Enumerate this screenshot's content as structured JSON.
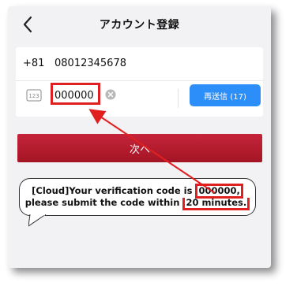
{
  "header": {
    "title": "アカウント登録",
    "back_icon": "chevron-left-icon"
  },
  "form": {
    "phone_prefix": "+81",
    "phone_number": "08012345678",
    "code_value": "000000",
    "keypad_icon_label": "123",
    "resend_label": "再送信 (17)"
  },
  "next_button": {
    "label": "次へ"
  },
  "sms": {
    "text_part1": "[Cloud]Your verification code is ",
    "code": "000000,",
    "line2_part1": "please submit the code within ",
    "line2_highlight": "20 minutes.",
    "line2_part2": ""
  },
  "colors": {
    "accent_red": "#e02020",
    "button_blue": "#2c8ef8",
    "button_red": "#b01c2e",
    "background": "#f2f2f4"
  }
}
